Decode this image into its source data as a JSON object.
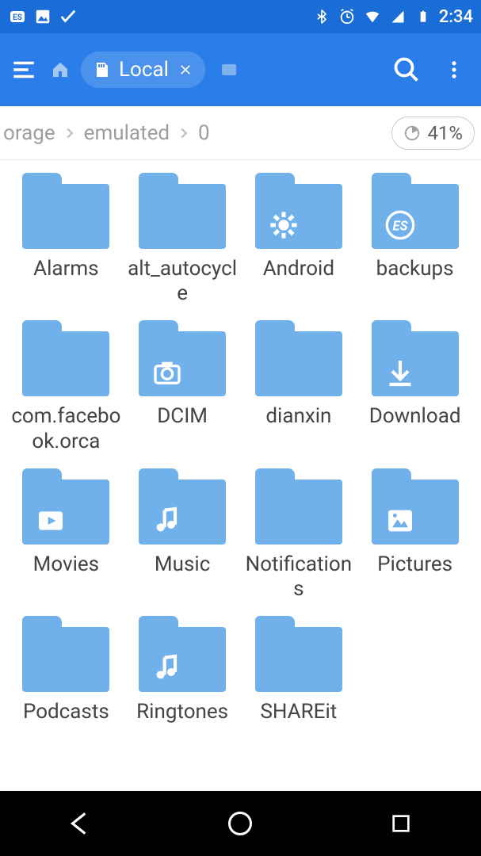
{
  "status": {
    "time": "2:34"
  },
  "toolbar": {
    "tab_label": "Local"
  },
  "breadcrumb": {
    "items": [
      "orage",
      "emulated",
      "0"
    ],
    "storage_percent": "41%"
  },
  "folders": [
    {
      "name": "Alarms",
      "icon": null
    },
    {
      "name": "alt_autocycle",
      "icon": null
    },
    {
      "name": "Android",
      "icon": "gear"
    },
    {
      "name": "backups",
      "icon": "es"
    },
    {
      "name": "com.facebook.orca",
      "icon": null
    },
    {
      "name": "DCIM",
      "icon": "camera"
    },
    {
      "name": "dianxin",
      "icon": null
    },
    {
      "name": "Download",
      "icon": "download"
    },
    {
      "name": "Movies",
      "icon": "play"
    },
    {
      "name": "Music",
      "icon": "music"
    },
    {
      "name": "Notifications",
      "icon": null
    },
    {
      "name": "Pictures",
      "icon": "picture"
    },
    {
      "name": "Podcasts",
      "icon": null
    },
    {
      "name": "Ringtones",
      "icon": "music"
    },
    {
      "name": "SHAREit",
      "icon": null
    }
  ]
}
